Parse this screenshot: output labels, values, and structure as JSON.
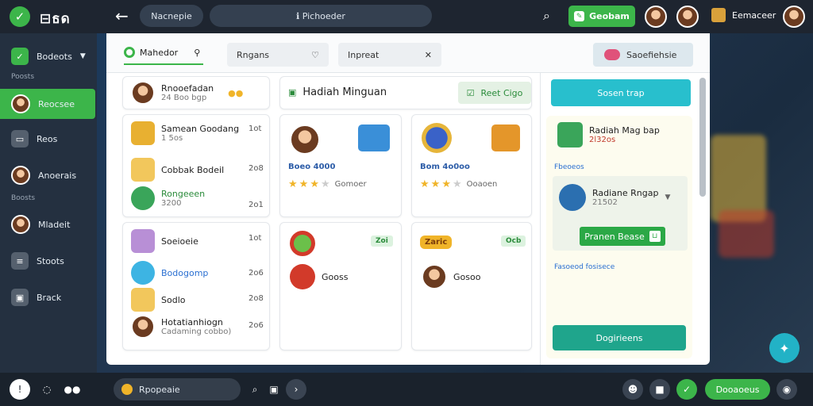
{
  "app": {
    "logo_text": "⊟ธด"
  },
  "topbar": {
    "nav_label": "Nacnepie",
    "search_text": "ℹ Pichoeder",
    "green_button": "Geobam",
    "user_name": "Eemaceer"
  },
  "sidebar": {
    "top_item": "Bodeots",
    "section1": "Poosts",
    "items": [
      "Reocsee",
      "Reos",
      "Anoerais"
    ],
    "section2": "Boosts",
    "items2": [
      "Mladeit",
      "Stoots",
      "Brack"
    ]
  },
  "tabs": {
    "active": "Mahedor",
    "chip1": "Rngans",
    "chip2": "Inpreat",
    "promo": "Saoefiehsie"
  },
  "left_column": {
    "profile": {
      "name": "Rnooefadan",
      "sub": "24 Boo bgp"
    },
    "list1": [
      {
        "title": "Samean Goodang",
        "sub": "1 5os",
        "num": "1ot"
      },
      {
        "title": "Cobbak Bodeil",
        "sub": "",
        "num": "2o8"
      },
      {
        "title": "Rongeeen",
        "sub": "3200",
        "num": "2o1"
      }
    ],
    "list2": [
      {
        "title": "Soeioeie",
        "sub": "",
        "num": "1ot"
      },
      {
        "title": "Bodogomp",
        "sub": "",
        "num": "2o6"
      },
      {
        "title": "Sodlo",
        "sub": "",
        "num": "2o8"
      },
      {
        "title": "Hotatianhiogn",
        "sub": "Cadaming cobbo)",
        "num": "2o6"
      }
    ]
  },
  "middle": {
    "header": "Hadiah Minguan",
    "header_btn": "Reet Cigo",
    "cards": [
      {
        "price": "Boeo 4000",
        "stars_label": "Gomoer"
      },
      {
        "price": "Bom 4o0oo",
        "stars_label": "Ooaoen"
      }
    ],
    "bottom_cards": [
      {
        "badge": "Zoi",
        "label": "Gooss"
      },
      {
        "badge": "Ocb",
        "label": "Gosoo",
        "sticker": "Zaric"
      }
    ]
  },
  "right_panel": {
    "top_button": "Sosen trap",
    "item_title": "Radiah Mag bap",
    "item_sub": "2l32os",
    "link1": "Fbeoeos",
    "selected_title": "Radiane Rngap",
    "selected_sub": "21502",
    "green_button": "Pranen Bease",
    "link2": "Fasoeod fosisece",
    "bottom_button": "Dogirieens"
  },
  "bottombar": {
    "pill_text": "Rpopeaie",
    "right_button": "Dooaoeus"
  },
  "colors": {
    "accent_green": "#3cb54a",
    "teal": "#28bfcd",
    "sidebar": "#243040",
    "topbar": "#1e2530"
  }
}
